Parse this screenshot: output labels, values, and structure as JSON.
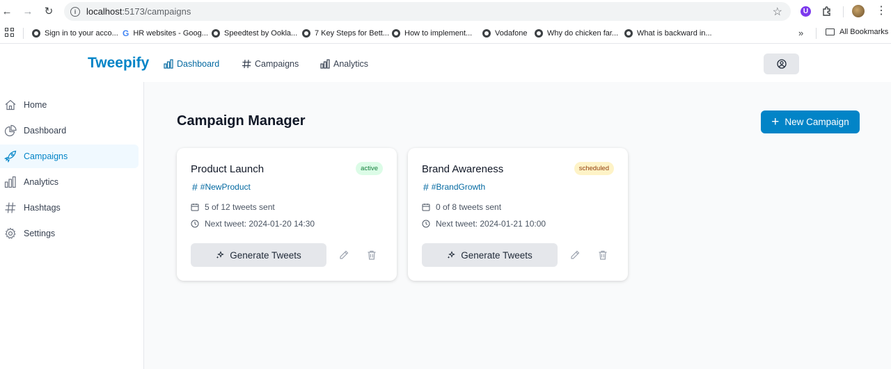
{
  "browser": {
    "url_host": "localhost",
    "url_path": ":5173/campaigns",
    "bookmarks": [
      {
        "label": "Sign in to your acco...",
        "icon": "globe-icon"
      },
      {
        "label": "HR websites - Goog...",
        "icon": "google-icon"
      },
      {
        "label": "Speedtest by Ookla...",
        "icon": "globe-icon"
      },
      {
        "label": "7 Key Steps for Bett...",
        "icon": "globe-icon"
      },
      {
        "label": "How to implement...",
        "icon": "globe-icon"
      },
      {
        "label": "Vodafone",
        "icon": "globe-icon"
      },
      {
        "label": "Why do chicken far...",
        "icon": "globe-icon"
      },
      {
        "label": "What is backward in...",
        "icon": "globe-icon"
      }
    ],
    "more": "»",
    "all_bookmarks": "All Bookmarks"
  },
  "header": {
    "brand": "Tweepify",
    "nav": [
      {
        "label": "Dashboard",
        "icon": "bar-chart-icon"
      },
      {
        "label": "Campaigns",
        "icon": "hash-icon"
      },
      {
        "label": "Analytics",
        "icon": "bar-chart-icon"
      }
    ]
  },
  "sidebar": {
    "items": [
      {
        "label": "Home",
        "icon": "home-icon"
      },
      {
        "label": "Dashboard",
        "icon": "pie-chart-icon"
      },
      {
        "label": "Campaigns",
        "icon": "rocket-icon",
        "active": true
      },
      {
        "label": "Analytics",
        "icon": "bar-chart-icon"
      },
      {
        "label": "Hashtags",
        "icon": "hash-icon"
      },
      {
        "label": "Settings",
        "icon": "gear-icon"
      }
    ]
  },
  "main": {
    "title": "Campaign Manager",
    "new_campaign_label": "New Campaign",
    "campaigns": [
      {
        "name": "Product Launch",
        "status": "active",
        "hashtag": "#NewProduct",
        "progress": "5 of 12 tweets sent",
        "next_tweet": "Next tweet: 2024-01-20 14:30",
        "generate_label": "Generate Tweets"
      },
      {
        "name": "Brand Awareness",
        "status": "scheduled",
        "hashtag": "#BrandGrowth",
        "progress": "0 of 8 tweets sent",
        "next_tweet": "Next tweet: 2024-01-21 10:00",
        "generate_label": "Generate Tweets"
      }
    ]
  },
  "colors": {
    "brand": "#0284c7",
    "active_badge_bg": "#dcfce7",
    "scheduled_badge_bg": "#fef3c7"
  }
}
